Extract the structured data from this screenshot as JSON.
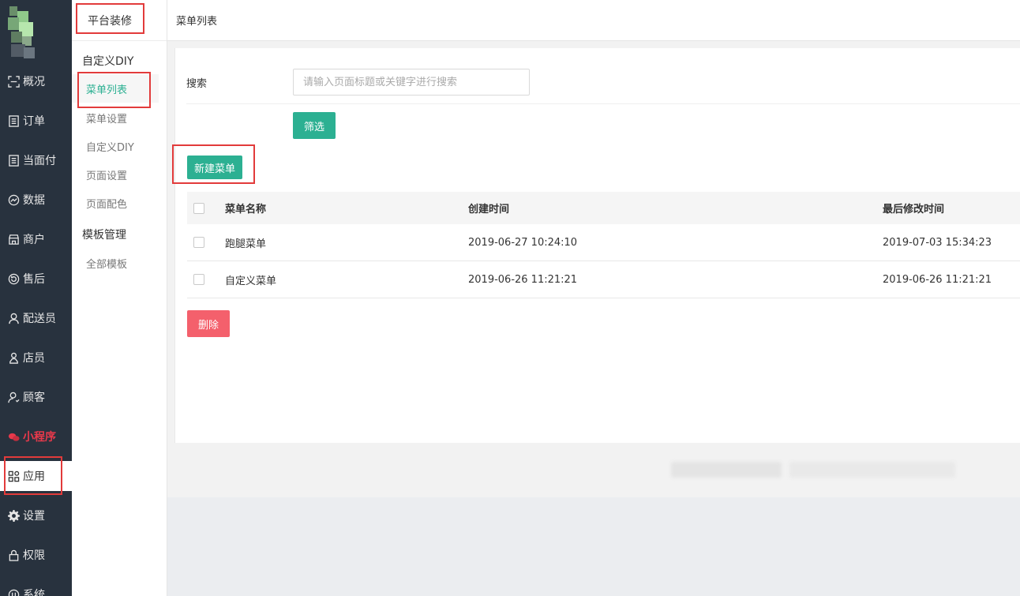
{
  "sidebar": {
    "items": [
      {
        "label": "概况",
        "icon": "overview-icon"
      },
      {
        "label": "订单",
        "icon": "order-icon"
      },
      {
        "label": "当面付",
        "icon": "pay-icon"
      },
      {
        "label": "数据",
        "icon": "data-icon"
      },
      {
        "label": "商户",
        "icon": "shop-icon"
      },
      {
        "label": "售后",
        "icon": "aftersale-icon"
      },
      {
        "label": "配送员",
        "icon": "courier-icon"
      },
      {
        "label": "店员",
        "icon": "clerk-icon"
      },
      {
        "label": "顾客",
        "icon": "customer-icon"
      },
      {
        "label": "小程序",
        "icon": "miniapp-icon"
      },
      {
        "label": "应用",
        "icon": "apps-icon"
      },
      {
        "label": "设置",
        "icon": "gear-icon"
      },
      {
        "label": "权限",
        "icon": "lock-icon"
      },
      {
        "label": "系统",
        "icon": "system-icon"
      }
    ],
    "accent_red": "#e8394b"
  },
  "subnav": {
    "title": "平台装修",
    "group1": "自定义DIY",
    "items1": [
      "菜单列表",
      "菜单设置",
      "自定义DIY",
      "页面设置",
      "页面配色"
    ],
    "group2": "模板管理",
    "items2": [
      "全部模板"
    ],
    "active_color": "#2cb092"
  },
  "header": {
    "title": "菜单列表"
  },
  "search": {
    "label": "搜索",
    "placeholder": "请输入页面标题或关键字进行搜索",
    "value": "",
    "filter_label": "筛选"
  },
  "actions": {
    "new_label": "新建菜单",
    "delete_label": "删除"
  },
  "table": {
    "headers": [
      "菜单名称",
      "创建时间",
      "最后修改时间"
    ],
    "rows": [
      {
        "name": "跑腿菜单",
        "created": "2019-06-27 10:24:10",
        "modified": "2019-07-03 15:34:23"
      },
      {
        "name": "自定义菜单",
        "created": "2019-06-26 11:21:21",
        "modified": "2019-06-26 11:21:21"
      }
    ]
  },
  "colors": {
    "primary": "#2cb092",
    "danger": "#f4606c",
    "highlight": "#e23b3b"
  }
}
